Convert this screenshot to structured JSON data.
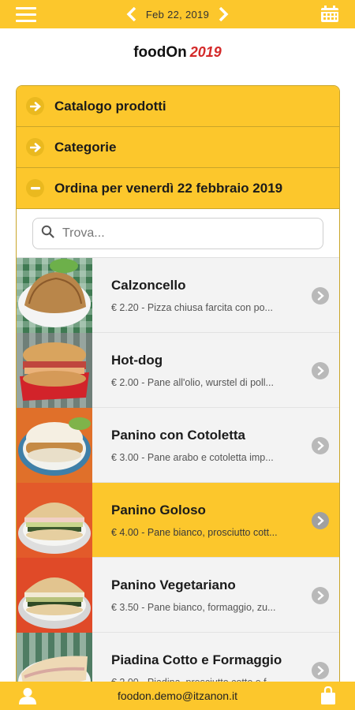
{
  "topbar": {
    "menu_icon": "hamburger-icon",
    "date": "Feb 22, 2019",
    "prev_icon": "chevron-left-icon",
    "next_icon": "chevron-right-icon",
    "calendar_icon": "calendar-icon"
  },
  "brand": {
    "name": "foodOn",
    "year": "2019"
  },
  "accordion": [
    {
      "label": "Catalogo prodotti",
      "icon": "arrow-right-circle-icon",
      "expanded": false
    },
    {
      "label": "Categorie",
      "icon": "arrow-right-circle-icon",
      "expanded": false
    },
    {
      "label": "Ordina per venerdì 22 febbraio 2019",
      "icon": "minus-circle-icon",
      "expanded": true
    }
  ],
  "search": {
    "placeholder": "Trova...",
    "value": "",
    "icon": "search-icon"
  },
  "products": [
    {
      "name": "Calzoncello",
      "desc": "€ 2.20 - Pizza chiusa farcita con po...",
      "selected": false
    },
    {
      "name": "Hot-dog",
      "desc": "€ 2.00 - Pane all'olio, wurstel di poll...",
      "selected": false
    },
    {
      "name": "Panino con Cotoletta",
      "desc": "€ 3.00 - Pane arabo e cotoletta imp...",
      "selected": false
    },
    {
      "name": "Panino Goloso",
      "desc": "€ 4.00 - Pane bianco, prosciutto cott...",
      "selected": true
    },
    {
      "name": "Panino Vegetariano",
      "desc": "€ 3.50 - Pane bianco, formaggio, zu...",
      "selected": false
    },
    {
      "name": "Piadina Cotto e Formaggio",
      "desc": "€ 2.00 - Piadina, prosciutto cotto e f...",
      "selected": false
    }
  ],
  "bottombar": {
    "email": "foodon.demo@itzanon.it",
    "user_icon": "user-icon",
    "bag_icon": "shopping-bag-icon"
  },
  "colors": {
    "accent": "#fcc72c",
    "year": "#d42a2a",
    "border": "#c9a52a"
  }
}
